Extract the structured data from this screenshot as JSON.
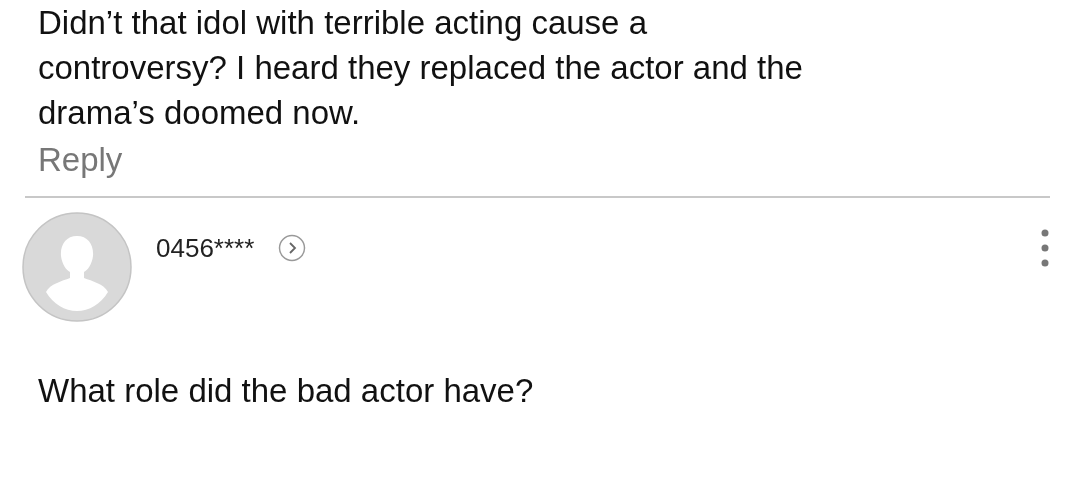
{
  "previous_comment": {
    "text": "Didn’t that idol with terrible acting cause a controversy? I heard they replaced the actor and the drama’s doomed now.",
    "reply_label": "Reply"
  },
  "comment": {
    "username": "0456****",
    "text": "What role did the bad actor have?"
  }
}
